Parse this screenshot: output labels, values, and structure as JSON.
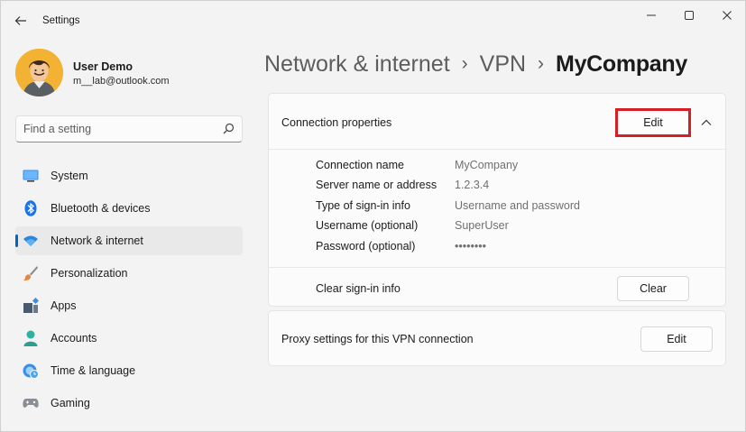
{
  "app": {
    "title": "Settings"
  },
  "user": {
    "name": "User Demo",
    "email": "m__lab@outlook.com"
  },
  "search": {
    "placeholder": "Find a setting"
  },
  "sidebar": {
    "items": [
      {
        "label": "System",
        "icon": "monitor-icon",
        "active": false
      },
      {
        "label": "Bluetooth & devices",
        "icon": "bluetooth-icon",
        "active": false
      },
      {
        "label": "Network & internet",
        "icon": "wifi-icon",
        "active": true
      },
      {
        "label": "Personalization",
        "icon": "paintbrush-icon",
        "active": false
      },
      {
        "label": "Apps",
        "icon": "apps-icon",
        "active": false
      },
      {
        "label": "Accounts",
        "icon": "person-icon",
        "active": false
      },
      {
        "label": "Time & language",
        "icon": "globe-clock-icon",
        "active": false
      },
      {
        "label": "Gaming",
        "icon": "gamepad-icon",
        "active": false
      }
    ]
  },
  "breadcrumb": {
    "items": [
      "Network & internet",
      "VPN"
    ],
    "current": "MyCompany",
    "separator": "›"
  },
  "connection_card": {
    "title": "Connection properties",
    "edit_label": "Edit",
    "properties": [
      {
        "label": "Connection name",
        "value": "MyCompany"
      },
      {
        "label": "Server name or address",
        "value": "1.2.3.4"
      },
      {
        "label": "Type of sign-in info",
        "value": "Username and password"
      },
      {
        "label": "Username (optional)",
        "value": "SuperUser"
      },
      {
        "label": "Password (optional)",
        "value": "••••••••"
      }
    ],
    "clear_label": "Clear sign-in info",
    "clear_button": "Clear"
  },
  "proxy_card": {
    "title": "Proxy settings for this VPN connection",
    "edit_label": "Edit"
  },
  "colors": {
    "accent": "#0067c0",
    "highlight": "#d51f26"
  }
}
